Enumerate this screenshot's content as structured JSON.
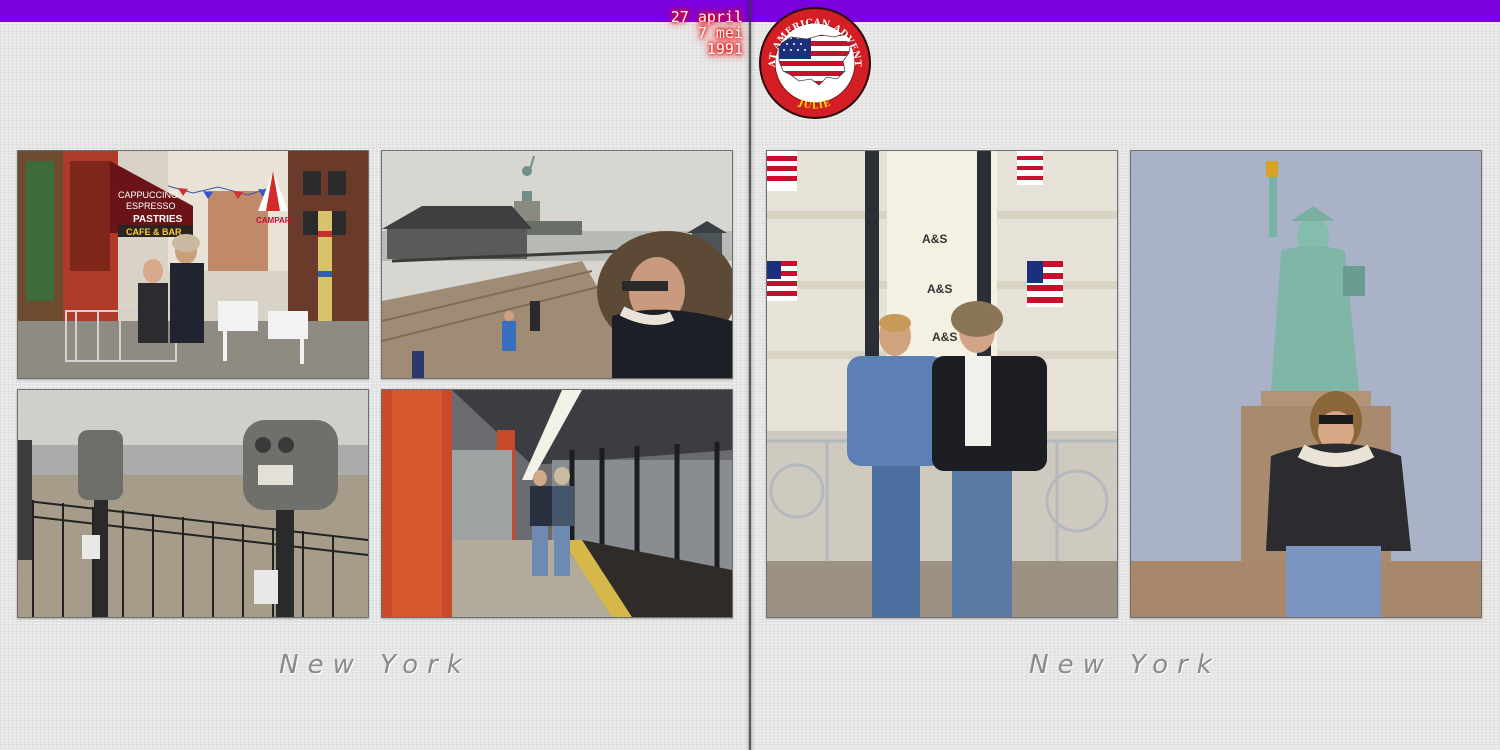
{
  "date_stamp": {
    "line1": "27 april",
    "line2": "7 mei",
    "line3": "1991"
  },
  "badge": {
    "arc_text": "GREAT AMERICAN ADVENTURE",
    "bottom_text": "JULIE"
  },
  "signs": {
    "cappuccino": "CAPPUCCINO",
    "espresso": "ESPRESSO",
    "pastries": "PASTRIES",
    "cafe_bar": "CAFE & BAR",
    "campari": "CAMPARI",
    "mall_sign": "A&S"
  },
  "captions": {
    "left": "New York",
    "right": "New York"
  },
  "colors": {
    "top_bar": "#7a00e0",
    "date_glow": "#e00000",
    "caption": "#8a8a8a"
  }
}
